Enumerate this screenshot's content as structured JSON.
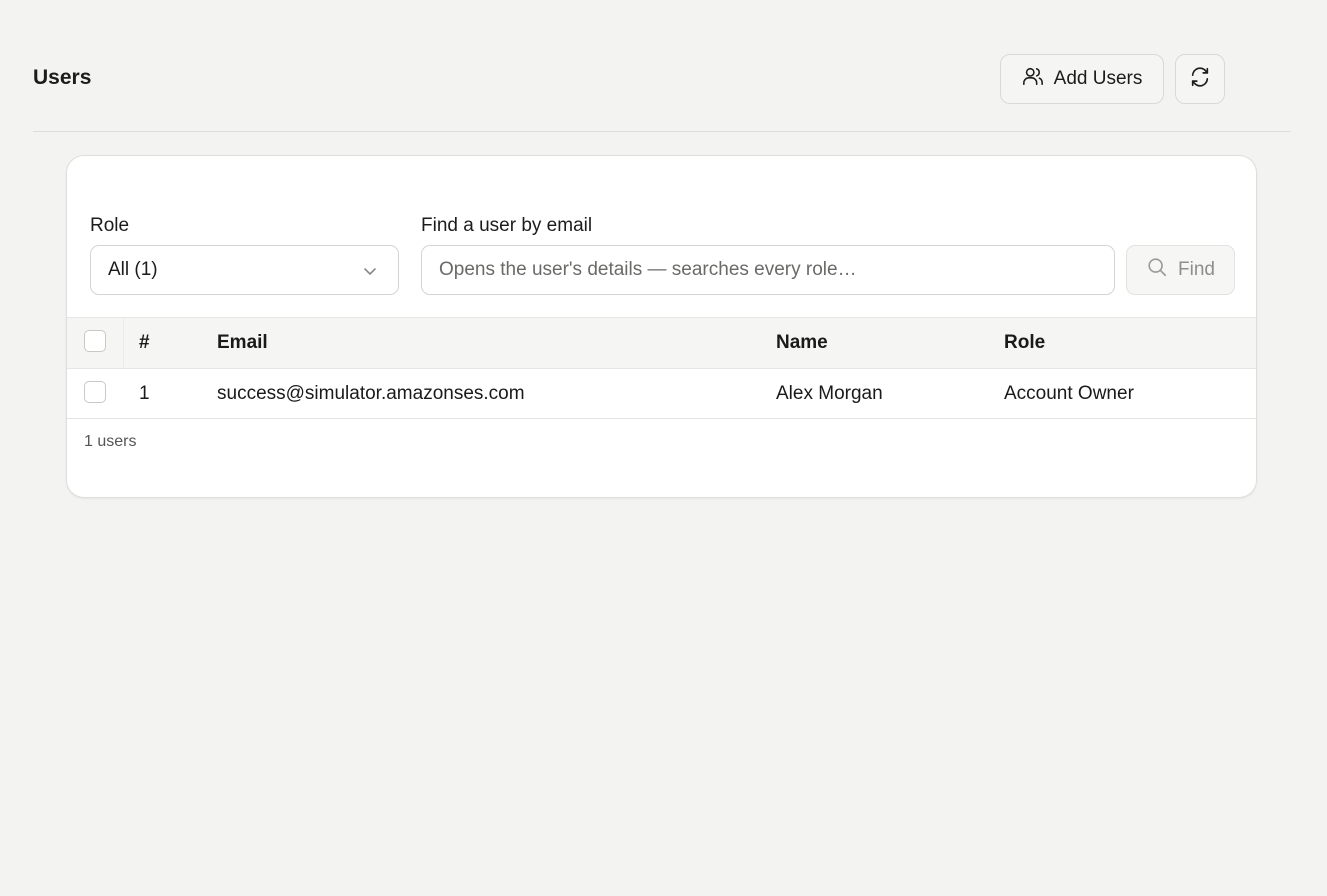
{
  "page": {
    "title": "Users",
    "add_users_label": "Add Users"
  },
  "filters": {
    "role_label": "Role",
    "role_selected": "All (1)",
    "search_label": "Find a user by email",
    "search_placeholder": "Opens the user's details — searches every role…",
    "find_label": "Find"
  },
  "table": {
    "columns": [
      "#",
      "Email",
      "Name",
      "Role"
    ],
    "rows": [
      {
        "index": "1",
        "email": "success@simulator.amazonses.com",
        "name": "Alex Morgan",
        "role": "Account Owner"
      }
    ]
  },
  "footer": {
    "count_text": "1 users"
  },
  "icons": {
    "add_users": "users-icon",
    "refresh": "refresh-icon",
    "select": "chevron-down-icon",
    "find": "search-icon"
  }
}
